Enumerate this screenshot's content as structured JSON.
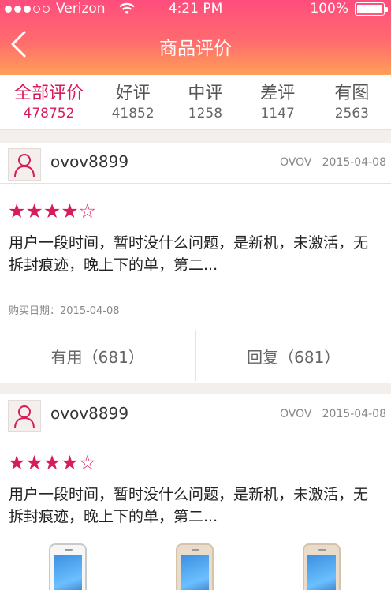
{
  "status": {
    "carrier": "Verizon",
    "time": "4:21 PM",
    "battery": "100%",
    "battery_level": 1.0,
    "signal_filled": 3,
    "signal_total": 5
  },
  "nav": {
    "title": "商品评价"
  },
  "tabs": [
    {
      "label": "全部评价",
      "count": "478752"
    },
    {
      "label": "好评",
      "count": "41852"
    },
    {
      "label": "中评",
      "count": "1258"
    },
    {
      "label": "差评",
      "count": "1147"
    },
    {
      "label": "有图",
      "count": "2563"
    }
  ],
  "reviews": [
    {
      "user": "ovov8899",
      "brand": "OVOV",
      "date": "2015-04-08",
      "rating": 4,
      "rating_max": 5,
      "stars_filled": "★★★★",
      "stars_empty": "☆",
      "text": "用户一段时间，暂时没什么问题，是新机，未激活，无拆封痕迹，晚上下的单，第二...",
      "buy_date": "购买日期：2015-04-08",
      "useful": "有用（681）",
      "reply": "回复（681）"
    },
    {
      "user": "ovov8899",
      "brand": "OVOV",
      "date": "2015-04-08",
      "rating": 4,
      "rating_max": 5,
      "stars_filled": "★★★★",
      "stars_empty": "☆",
      "text": "用户一段时间，暂时没什么问题，是新机，未激活，无拆封痕迹，晚上下的单，第二..."
    }
  ],
  "icons": {
    "back": "chevron-left-icon",
    "avatar": "user-icon",
    "wifi": "wifi-icon",
    "battery": "battery-icon"
  },
  "colors": {
    "accent": "#d81b5a",
    "gradient_top": "#ff4d7d",
    "gradient_bottom": "#ff9f57"
  }
}
